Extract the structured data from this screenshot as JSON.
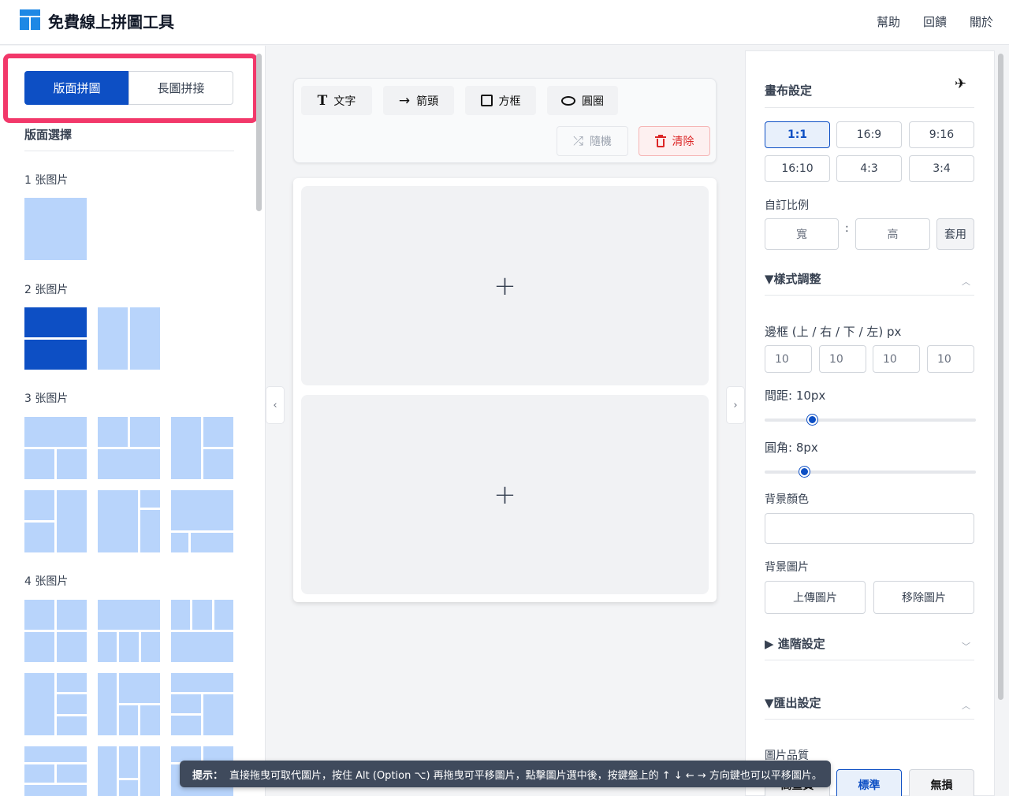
{
  "header": {
    "app_title": "免費線上拼圖工具",
    "nav": [
      "幫助",
      "回饋",
      "關於"
    ]
  },
  "left": {
    "modes": [
      "版面拼圖",
      "長圖拼接"
    ],
    "section_title": "版面選擇",
    "groups": [
      "1 张图片",
      "2 张图片",
      "3 张图片",
      "4 张图片"
    ]
  },
  "toolbar": {
    "text": "文字",
    "arrow": "箭頭",
    "box": "方框",
    "circle": "圓圈",
    "random": "隨機",
    "clear": "清除"
  },
  "canvas": {
    "plus": "+"
  },
  "collapse": {
    "left": "‹",
    "right": "›"
  },
  "right": {
    "canvas_settings": "畫布設定",
    "ratios": [
      "1:1",
      "16:9",
      "9:16",
      "16:10",
      "4:3",
      "3:4"
    ],
    "custom_ratio": "自訂比例",
    "width_placeholder": "寬",
    "colon": ":",
    "height_placeholder": "高",
    "apply": "套用",
    "style_adjust": "▼樣式調整",
    "border_label": "邊框 (上 / 右 / 下 / 左) px",
    "border_values": [
      "10",
      "10",
      "10",
      "10"
    ],
    "spacing_label": "間距: 10px",
    "spacing_value": 10,
    "radius_label": "圓角: 8px",
    "radius_value": 8,
    "bg_color_label": "背景顏色",
    "bg_image_label": "背景圖片",
    "upload": "上傳圖片",
    "remove": "移除圖片",
    "advanced": "▶ 進階設定",
    "export": "▼匯出設定",
    "quality_label": "圖片品質",
    "qualities": [
      "高畫質",
      "標準",
      "無損"
    ]
  },
  "tip": {
    "label": "提示：",
    "text": "直接拖曳可取代圖片，按住 Alt (Option ⌥) 再拖曳可平移圖片，點擊圖片選中後，按鍵盤上的 ↑ ↓ ← → 方向鍵也可以平移圖片。"
  }
}
